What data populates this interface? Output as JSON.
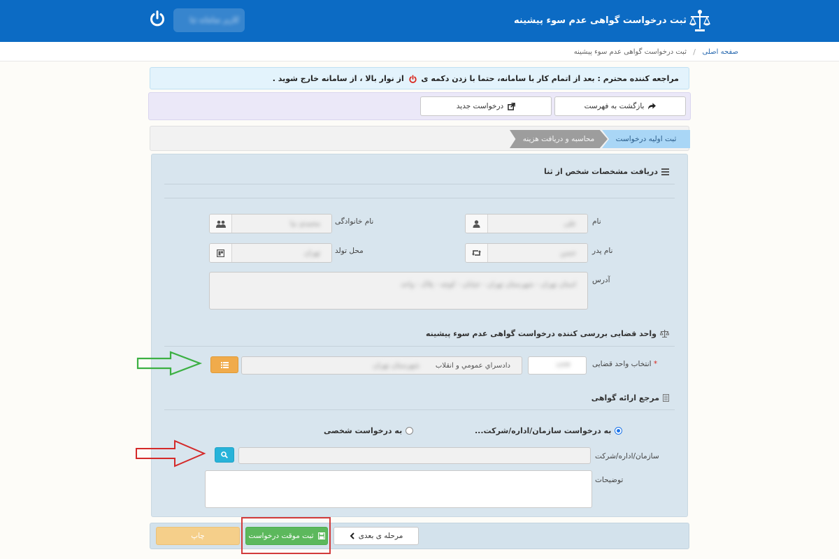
{
  "header": {
    "title": "ثبت درخواست گواهی عدم سوء پیشینه",
    "user_name": "کاربر سامانه ثنا"
  },
  "breadcrumb": {
    "home": "صفحه اصلی",
    "separator": "/",
    "current": "ثبت درخواست گواهی عدم سوء پیشینه"
  },
  "notice": {
    "part1": "مراجعه کننده محترم : بعد از اتمام کار با سامانه، حتما با زدن دکمه ی",
    "part2": "از نوار بالا ، از سامانه خارج شوید ."
  },
  "toolbar": {
    "back_label": "بازگشت به فهرست",
    "new_label": "درخواست جدید"
  },
  "steps": [
    {
      "label": "ثبت اولیه درخواست",
      "active": true
    },
    {
      "label": "محاسبه و دریافت هزینه",
      "active": false
    }
  ],
  "person": {
    "section_title": "دریافت مشخصات شخص از ثنا",
    "first_name_label": "نام",
    "first_name_value": "علی",
    "last_name_label": "نام خانوادگی",
    "last_name_value": "محمدی نیا",
    "father_label": "نام پدر",
    "father_value": "حسن",
    "birthplace_label": "محل تولد",
    "birthplace_value": "تهران",
    "address_label": "آدرس",
    "address_value": "استان تهران - شهرستان تهران - خیابان - کوچه - پلاک - واحد"
  },
  "judicial": {
    "section_title": "واحد قضایی بررسی کننده درخواست گواهی عدم سوء پیشینه",
    "select_label": "انتخاب واحد قضایی",
    "required_mark": "*",
    "code_value": "۱۲۳۴",
    "unit_name": "دادسراي عمومي و انقلاب",
    "unit_blurred": "شهرستان تهران"
  },
  "reference": {
    "section_title": "مرجع ارائه گواهی",
    "option_org": "به درخواست سازمان/اداره/شرکت...",
    "option_personal": "به درخواست شخصی",
    "org_label": "سازمان/اداره/شرکت",
    "desc_label": "توضیحات"
  },
  "footer": {
    "next_label": "مرحله ی بعدی",
    "save_label": "ثبت موقت درخواست",
    "print_label": "چاپ"
  },
  "colors": {
    "header_bg": "#0c6bc4",
    "panel_bg": "#d8e5ee",
    "step_active": "#a9d6f6",
    "step_inactive": "#9d9d9d",
    "save_green": "#5cb85c",
    "orange_btn": "#f0ab4b",
    "cyan_btn": "#27b3d9",
    "arrow_green": "#3cb043",
    "arrow_red": "#d42a2a"
  },
  "icons": {
    "emblem": "scales-emblem-icon",
    "power": "power-icon",
    "back": "share-arrow-icon",
    "new": "external-link-icon",
    "list": "list-icon",
    "user": "user-icon",
    "users": "users-icon",
    "retweet": "retweet-icon",
    "map": "map-marker-icon",
    "balance": "balance-scale-icon",
    "file": "file-icon",
    "search": "search-icon",
    "save": "floppy-icon",
    "chevron": "chevron-left-icon"
  }
}
